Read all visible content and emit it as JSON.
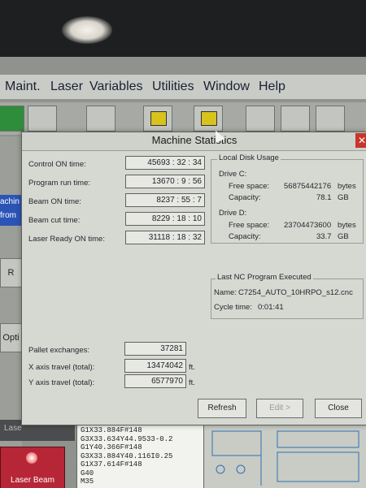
{
  "menu": [
    "Maint.",
    "Laser",
    "Variables",
    "Utilities",
    "Window",
    "Help"
  ],
  "left_panel": {
    "blue_text_1": "achin",
    "blue_text_2": "from",
    "btn_r": "R",
    "btn_opti": "Opti"
  },
  "dialog": {
    "title": "Machine Statistics",
    "close_symbol": "✕",
    "stats": [
      {
        "label": "Control ON time:",
        "value": "45693 : 32 : 34"
      },
      {
        "label": "Program run time:",
        "value": "13670 :  9 : 56"
      },
      {
        "label": "Beam ON time:",
        "value": "8237 : 55 :  7"
      },
      {
        "label": "Beam cut time:",
        "value": "8229 : 18 : 10"
      },
      {
        "label": "Laser Ready ON time:",
        "value": "31118 : 18 : 32"
      }
    ],
    "disk": {
      "group_title": "Local Disk Usage",
      "drive_c": {
        "name": "Drive C:",
        "free_label": "Free space:",
        "free_value": "56875442176",
        "free_unit": "bytes",
        "cap_label": "Capacity:",
        "cap_value": "78.1",
        "cap_unit": "GB"
      },
      "drive_d": {
        "name": "Drive D:",
        "free_label": "Free space:",
        "free_value": "23704473600",
        "free_unit": "bytes",
        "cap_label": "Capacity:",
        "cap_value": "33.7",
        "cap_unit": "GB"
      }
    },
    "last_nc": {
      "group_title": "Last NC Program Executed",
      "name_label": "Name:",
      "name_value": "C7254_AUTO_10HRPO_s12.cnc",
      "cycle_label": "Cycle time:",
      "cycle_value": "0:01:41"
    },
    "totals": [
      {
        "label": "Pallet exchanges:",
        "value": "37281",
        "unit": ""
      },
      {
        "label": "X axis travel (total):",
        "value": "13474042",
        "unit": "ft."
      },
      {
        "label": "Y axis travel (total):",
        "value": "6577970",
        "unit": "ft."
      }
    ],
    "buttons": {
      "refresh": "Refresh",
      "edit": "Edit >",
      "close": "Close"
    }
  },
  "editor_lines": [
    "G1X33.884F#148",
    "G3X33.634Y44.9533-0.2",
    "G1Y40.366F#148",
    "G3X33.884Y40.116I0.25",
    "G1X37.614F#148",
    "G40",
    "M35"
  ],
  "laser_button_label": "Laser Beam",
  "bottom_tab_label": "Lase"
}
